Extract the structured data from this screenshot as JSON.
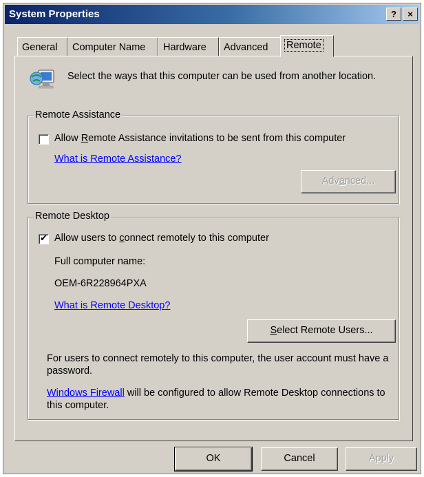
{
  "window": {
    "title": "System Properties",
    "help_btn": "?",
    "close_btn": "×"
  },
  "tabs": [
    "General",
    "Computer Name",
    "Hardware",
    "Advanced",
    "Remote"
  ],
  "intro": "Select the ways that this computer can be used from another location.",
  "remote_assistance": {
    "group_label": "Remote Assistance",
    "checkbox_label_pre": "Allow ",
    "checkbox_label_key": "R",
    "checkbox_label_post": "emote Assistance invitations to be sent from this computer",
    "checked": false,
    "link": "What is Remote Assistance?",
    "advanced_pre": "Adv",
    "advanced_key": "a",
    "advanced_post": "nced..."
  },
  "remote_desktop": {
    "group_label": "Remote Desktop",
    "checkbox_label_pre": "Allow users to ",
    "checkbox_label_key": "c",
    "checkbox_label_post": "onnect remotely to this computer",
    "checked": true,
    "full_name_label": "Full computer name:",
    "computer_name": "OEM-6R228964PXA",
    "link": "What is Remote Desktop?",
    "select_users_key": "S",
    "select_users_post": "elect Remote Users...",
    "note": "For users to connect remotely to this computer, the user account must have a password.",
    "firewall_link": "Windows Firewall",
    "firewall_text": " will be configured to allow Remote Desktop connections to this computer."
  },
  "buttons": {
    "ok": "OK",
    "cancel": "Cancel",
    "apply": "Apply"
  }
}
